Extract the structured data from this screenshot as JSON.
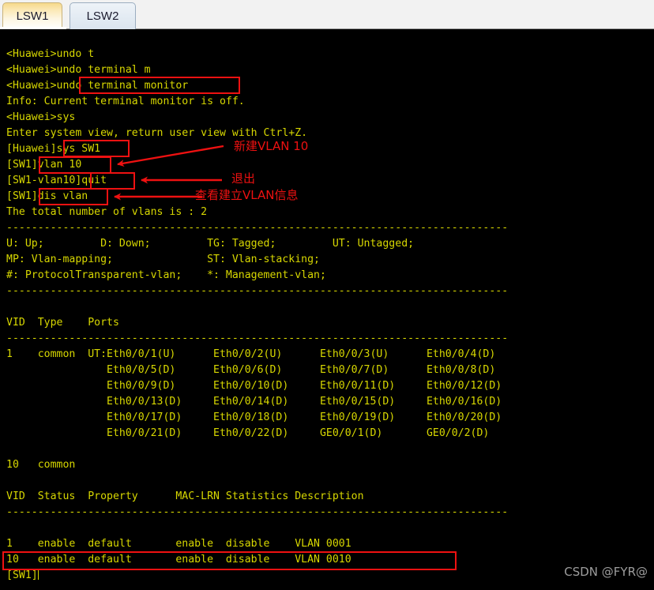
{
  "window": {
    "tabs": [
      {
        "label": "LSW1",
        "active": true
      },
      {
        "label": "LSW2",
        "active": false
      }
    ]
  },
  "terminal": {
    "fg_color": "#d7d700",
    "bg_color": "#000000",
    "lines": [
      "<Huawei>undo t",
      "<Huawei>undo terminal m",
      "<Huawei>undo terminal monitor",
      "Info: Current terminal monitor is off.",
      "<Huawei>sys",
      "Enter system view, return user view with Ctrl+Z.",
      "[Huawei]sys SW1",
      "[SW1]vlan 10",
      "[SW1-vlan10]quit",
      "[SW1]dis vlan",
      "The total number of vlans is : 2",
      "--------------------------------------------------------------------------------",
      "U: Up;         D: Down;         TG: Tagged;         UT: Untagged;",
      "MP: Vlan-mapping;               ST: Vlan-stacking;",
      "#: ProtocolTransparent-vlan;    *: Management-vlan;",
      "--------------------------------------------------------------------------------",
      "",
      "VID  Type    Ports",
      "--------------------------------------------------------------------------------",
      "1    common  UT:Eth0/0/1(U)      Eth0/0/2(U)      Eth0/0/3(U)      Eth0/0/4(D)",
      "                Eth0/0/5(D)      Eth0/0/6(D)      Eth0/0/7(D)      Eth0/0/8(D)",
      "                Eth0/0/9(D)      Eth0/0/10(D)     Eth0/0/11(D)     Eth0/0/12(D)",
      "                Eth0/0/13(D)     Eth0/0/14(D)     Eth0/0/15(D)     Eth0/0/16(D)",
      "                Eth0/0/17(D)     Eth0/0/18(D)     Eth0/0/19(D)     Eth0/0/20(D)",
      "                Eth0/0/21(D)     Eth0/0/22(D)     GE0/0/1(D)       GE0/0/2(D)",
      "",
      "10   common",
      "",
      "VID  Status  Property      MAC-LRN Statistics Description",
      "--------------------------------------------------------------------------------",
      "",
      "1    enable  default       enable  disable    VLAN 0001",
      "10   enable  default       enable  disable    VLAN 0010",
      "[SW1]"
    ]
  },
  "annotations": {
    "color": "#ee1111",
    "texts": [
      {
        "label": "新建VLAN 10"
      },
      {
        "label": "退出"
      },
      {
        "label": "查看建立VLAN信息"
      }
    ],
    "highlight_boxes": [
      {
        "target": "undo terminal monitor"
      },
      {
        "target": "sys SW1"
      },
      {
        "target": "vlan 10"
      },
      {
        "target": "quit"
      },
      {
        "target": "dis vlan"
      },
      {
        "target": "10   enable  default       enable  disable    VLAN 0010"
      }
    ]
  },
  "watermark": {
    "text": "CSDN @FYR@"
  }
}
